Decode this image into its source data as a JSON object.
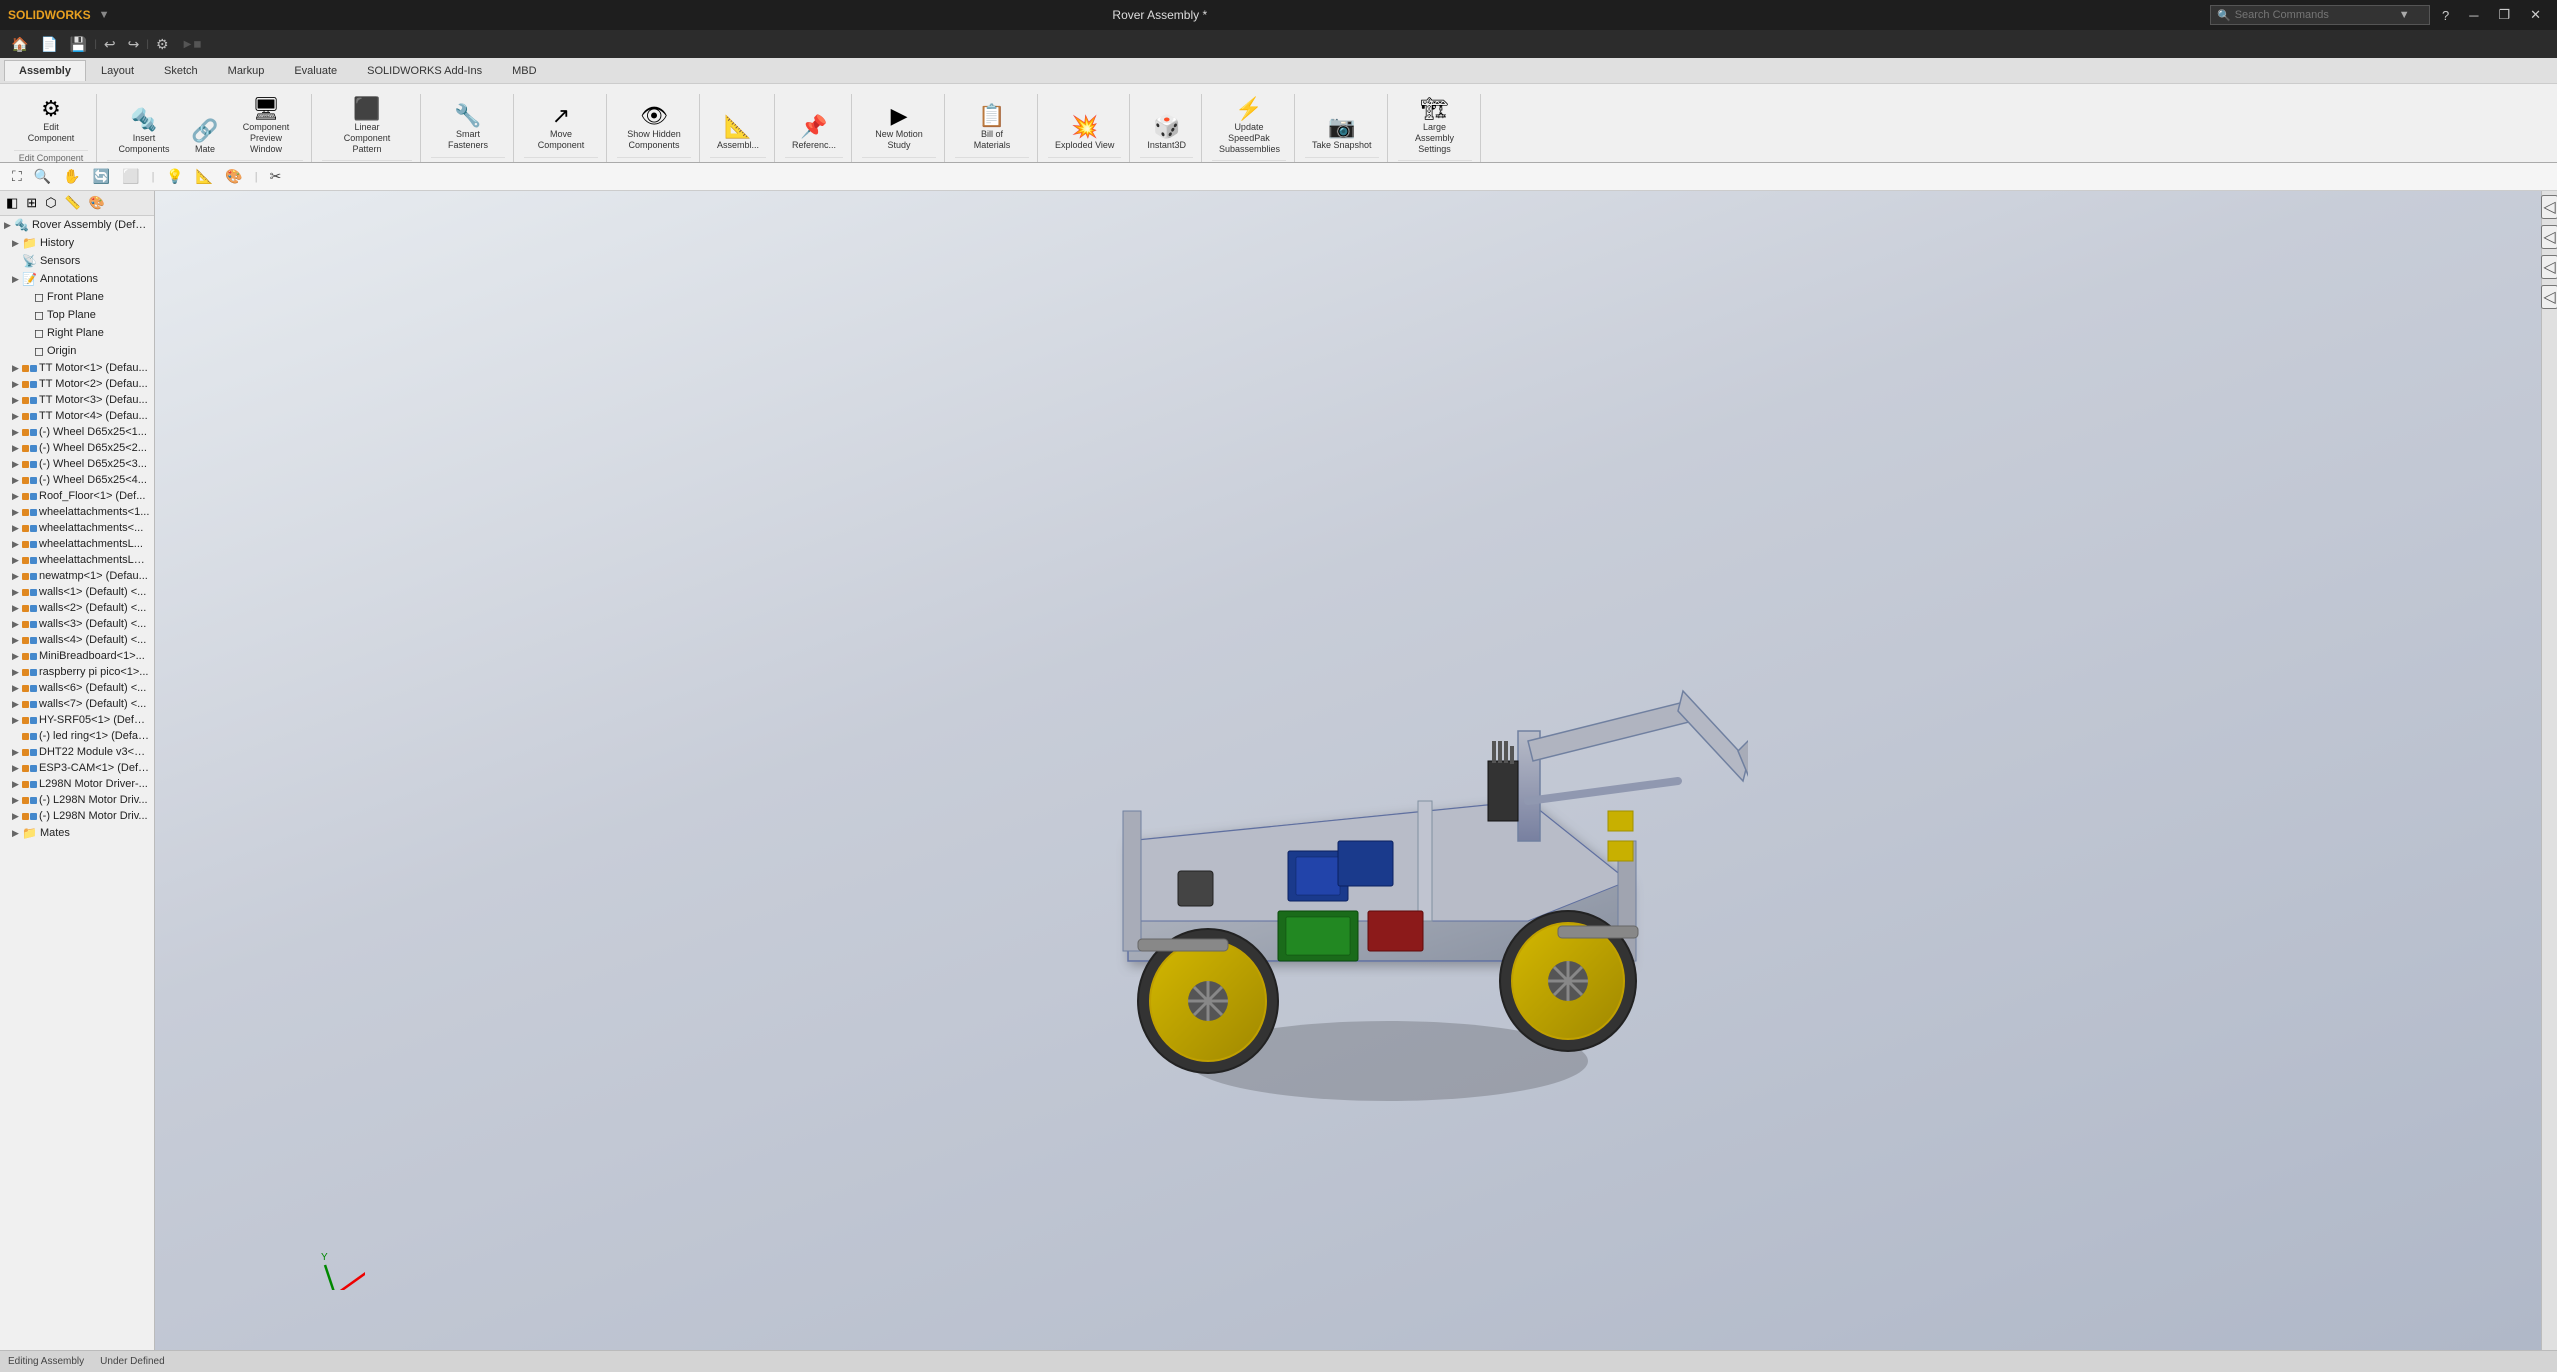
{
  "titlebar": {
    "logo": "SOLIDWORKS",
    "title": "Rover Assembly *",
    "search_placeholder": "Search Commands",
    "window_controls": [
      "minimize",
      "restore",
      "close"
    ]
  },
  "quickaccess": {
    "buttons": [
      "🏠",
      "📄",
      "💾",
      "↩",
      "↪",
      "⚙"
    ]
  },
  "ribbon": {
    "tabs": [
      "Assembly",
      "Layout",
      "Sketch",
      "Markup",
      "Evaluate",
      "SOLIDWORKS Add-Ins",
      "MBD"
    ],
    "active_tab": "Assembly",
    "groups": [
      {
        "label": "Edit Component",
        "items": [
          {
            "icon": "⚙",
            "label": "Edit\nComponent"
          }
        ]
      },
      {
        "label": "",
        "items": [
          {
            "icon": "➕",
            "label": "Insert\nComponents"
          },
          {
            "icon": "🔩",
            "label": "Mate"
          },
          {
            "icon": "🖼",
            "label": "Component\nPreview Window"
          }
        ]
      },
      {
        "label": "",
        "items": [
          {
            "icon": "⬛",
            "label": "Linear Component Pattern"
          }
        ]
      },
      {
        "label": "",
        "items": [
          {
            "icon": "🔧",
            "label": "Smart\nFasteners"
          }
        ]
      },
      {
        "label": "",
        "items": [
          {
            "icon": "↗",
            "label": "Move Component"
          }
        ]
      },
      {
        "label": "",
        "items": [
          {
            "icon": "👁",
            "label": "Show Hidden\nComponents"
          }
        ]
      },
      {
        "label": "",
        "items": [
          {
            "icon": "📐",
            "label": "Assembl..."
          }
        ]
      },
      {
        "label": "",
        "items": [
          {
            "icon": "📌",
            "label": "Referenc..."
          }
        ]
      },
      {
        "label": "",
        "items": [
          {
            "icon": "▶",
            "label": "New Motion\nStudy"
          }
        ]
      },
      {
        "label": "",
        "items": [
          {
            "icon": "📋",
            "label": "Bill of\nMaterials"
          }
        ]
      },
      {
        "label": "",
        "items": [
          {
            "icon": "💥",
            "label": "Exploded View"
          }
        ]
      },
      {
        "label": "",
        "items": [
          {
            "icon": "🎲",
            "label": "Instant3D"
          }
        ]
      },
      {
        "label": "",
        "items": [
          {
            "icon": "⚡",
            "label": "Update SpeedPak\nSubassemblies"
          }
        ]
      },
      {
        "label": "",
        "items": [
          {
            "icon": "📷",
            "label": "Take\nSnapshot"
          }
        ]
      },
      {
        "label": "",
        "items": [
          {
            "icon": "🏗",
            "label": "Large Assembly\nSettings"
          }
        ]
      }
    ]
  },
  "tree": {
    "root": "Rover Assembly (Defau...",
    "items": [
      {
        "indent": 1,
        "arrow": "▶",
        "icon": "📁",
        "label": "History",
        "has_arrow": true
      },
      {
        "indent": 1,
        "arrow": " ",
        "icon": "📡",
        "label": "Sensors"
      },
      {
        "indent": 1,
        "arrow": "▶",
        "icon": "📝",
        "label": "Annotations",
        "has_arrow": true
      },
      {
        "indent": 2,
        "arrow": " ",
        "icon": "◻",
        "label": "Front Plane"
      },
      {
        "indent": 2,
        "arrow": " ",
        "icon": "◻",
        "label": "Top Plane"
      },
      {
        "indent": 2,
        "arrow": " ",
        "icon": "◻",
        "label": "Right Plane"
      },
      {
        "indent": 2,
        "arrow": " ",
        "icon": "✦",
        "label": "Origin"
      },
      {
        "indent": 1,
        "arrow": "▶",
        "icon": "⚙",
        "label": "TT Motor<1> (Defau..."
      },
      {
        "indent": 1,
        "arrow": "▶",
        "icon": "⚙",
        "label": "TT Motor<2> (Defau..."
      },
      {
        "indent": 1,
        "arrow": "▶",
        "icon": "⚙",
        "label": "TT Motor<3> (Defau..."
      },
      {
        "indent": 1,
        "arrow": "▶",
        "icon": "⚙",
        "label": "TT Motor<4> (Defau..."
      },
      {
        "indent": 1,
        "arrow": "▶",
        "icon": "⚙",
        "label": "(-) Wheel D65x25<1..."
      },
      {
        "indent": 1,
        "arrow": "▶",
        "icon": "⚙",
        "label": "(-) Wheel D65x25<2..."
      },
      {
        "indent": 1,
        "arrow": "▶",
        "icon": "⚙",
        "label": "(-) Wheel D65x25<3..."
      },
      {
        "indent": 1,
        "arrow": "▶",
        "icon": "⚙",
        "label": "(-) Wheel D65x25<4..."
      },
      {
        "indent": 1,
        "arrow": "▶",
        "icon": "⚙",
        "label": "Roof_Floor<1> (Def..."
      },
      {
        "indent": 1,
        "arrow": "▶",
        "icon": "⚙",
        "label": "wheelattachments<1..."
      },
      {
        "indent": 1,
        "arrow": "▶",
        "icon": "⚙",
        "label": "wheelattachments<..."
      },
      {
        "indent": 1,
        "arrow": "▶",
        "icon": "⚙",
        "label": "wheelattachmentsL..."
      },
      {
        "indent": 1,
        "arrow": "▶",
        "icon": "⚙",
        "label": "wheelattachmentsLE..."
      },
      {
        "indent": 1,
        "arrow": "▶",
        "icon": "⚙",
        "label": "newatmp<1> (Defau..."
      },
      {
        "indent": 1,
        "arrow": "▶",
        "icon": "⚙",
        "label": "walls<1> (Default) <..."
      },
      {
        "indent": 1,
        "arrow": "▶",
        "icon": "⚙",
        "label": "walls<2> (Default) <..."
      },
      {
        "indent": 1,
        "arrow": "▶",
        "icon": "⚙",
        "label": "walls<3> (Default) <..."
      },
      {
        "indent": 1,
        "arrow": "▶",
        "icon": "⚙",
        "label": "walls<4> (Default) <..."
      },
      {
        "indent": 1,
        "arrow": "▶",
        "icon": "⚙",
        "label": "MiniBreadboard<1>..."
      },
      {
        "indent": 1,
        "arrow": "▶",
        "icon": "⚙",
        "label": "raspberry pi pico<1>..."
      },
      {
        "indent": 1,
        "arrow": "▶",
        "icon": "⚙",
        "label": "walls<6> (Default) <..."
      },
      {
        "indent": 1,
        "arrow": "▶",
        "icon": "⚙",
        "label": "walls<7> (Default) <..."
      },
      {
        "indent": 1,
        "arrow": "▶",
        "icon": "⚙",
        "label": "HY-SRF05<1> (Default)"
      },
      {
        "indent": 1,
        "arrow": " ",
        "icon": "⚙",
        "label": "(-) led ring<1> (Default..."
      },
      {
        "indent": 1,
        "arrow": "▶",
        "icon": "⚙",
        "label": "DHT22 Module v3<1>..."
      },
      {
        "indent": 1,
        "arrow": "▶",
        "icon": "⚙",
        "label": "ESP3-CAM<1> (Defa..."
      },
      {
        "indent": 1,
        "arrow": "▶",
        "icon": "⚙",
        "label": "L298N Motor Driver-..."
      },
      {
        "indent": 1,
        "arrow": "▶",
        "icon": "⚙",
        "label": "(-) L298N Motor Driv..."
      },
      {
        "indent": 1,
        "arrow": "▶",
        "icon": "⚙",
        "label": "(-) L298N Motor Driv..."
      },
      {
        "indent": 1,
        "arrow": "▶",
        "icon": "📁",
        "label": "Mates"
      }
    ]
  },
  "status_bar": {
    "items": [
      "Editing Assembly",
      "Under Defined",
      ""
    ]
  },
  "viewport_toolbar": {
    "icons": [
      "🔍",
      "🔭",
      "📐",
      "🔄",
      "🖱",
      "💡",
      "🎨",
      "📷"
    ]
  }
}
